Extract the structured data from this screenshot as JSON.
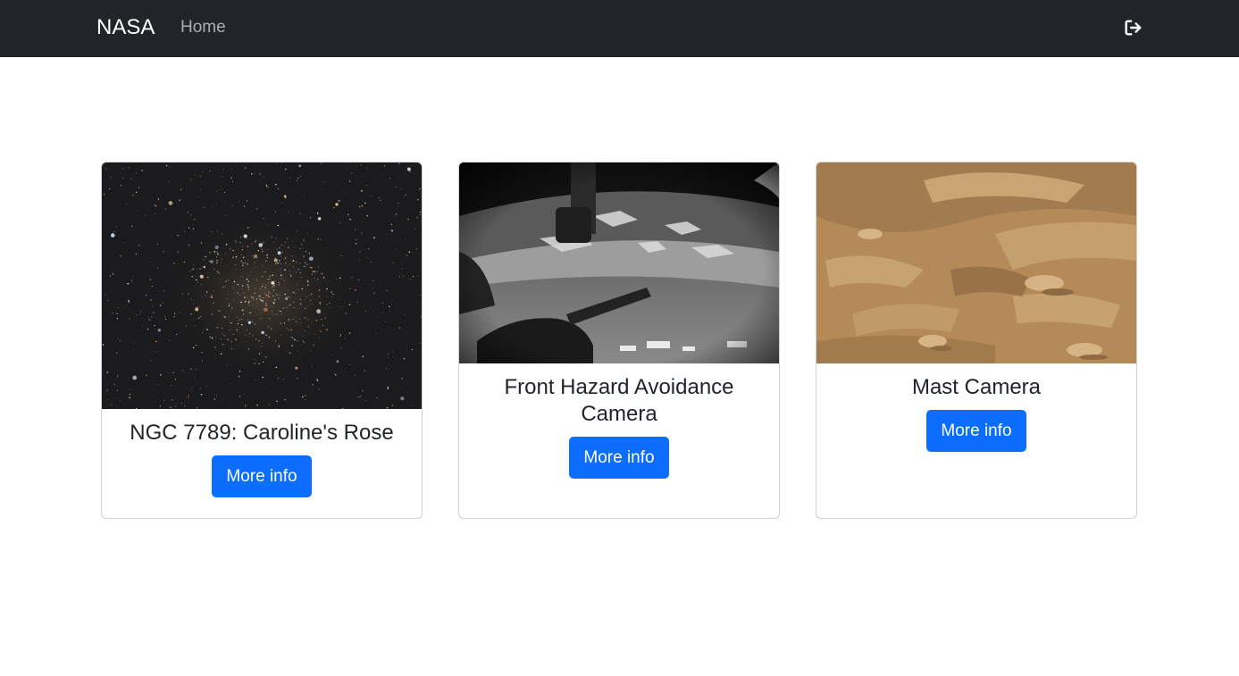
{
  "navbar": {
    "brand": "NASA",
    "home_label": "Home",
    "logout_icon": "logout-icon"
  },
  "cards": [
    {
      "title": "NGC 7789: Caroline's Rose",
      "button_label": "More info"
    },
    {
      "title": "Front Hazard Avoidance Camera",
      "button_label": "More info"
    },
    {
      "title": "Mast Camera",
      "button_label": "More info"
    }
  ],
  "colors": {
    "navbar_bg": "#212529",
    "button_bg": "#0d6efd",
    "card_border": "#d9d9d9"
  }
}
